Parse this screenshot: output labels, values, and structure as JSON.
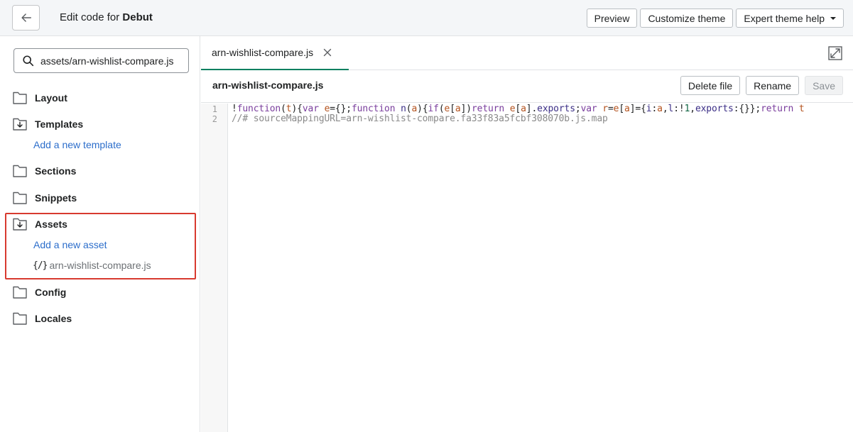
{
  "header": {
    "title_prefix": "Edit code for",
    "theme_name": "Debut",
    "buttons": {
      "preview": "Preview",
      "customize": "Customize theme",
      "expert_help": "Expert theme help"
    }
  },
  "sidebar": {
    "search_value": "assets/arn-wishlist-compare.js",
    "folders": {
      "layout": "Layout",
      "templates": "Templates",
      "sections": "Sections",
      "snippets": "Snippets",
      "assets": "Assets",
      "config": "Config",
      "locales": "Locales"
    },
    "add_template": "Add a new template",
    "add_asset": "Add a new asset",
    "asset_file": "arn-wishlist-compare.js",
    "asset_file_icon": "{/}"
  },
  "editor": {
    "tab_label": "arn-wishlist-compare.js",
    "filename": "arn-wishlist-compare.js",
    "buttons": {
      "delete": "Delete file",
      "rename": "Rename",
      "save": "Save"
    },
    "line_numbers": [
      "1",
      "2"
    ],
    "line1_tokens": [
      {
        "t": "!",
        "c": "plain"
      },
      {
        "t": "function",
        "c": "kw"
      },
      {
        "t": "(",
        "c": "plain"
      },
      {
        "t": "t",
        "c": "var"
      },
      {
        "t": "){",
        "c": "plain"
      },
      {
        "t": "var",
        "c": "kw"
      },
      {
        "t": " ",
        "c": "plain"
      },
      {
        "t": "e",
        "c": "var"
      },
      {
        "t": "={};",
        "c": "plain"
      },
      {
        "t": "function",
        "c": "kw"
      },
      {
        "t": " ",
        "c": "plain"
      },
      {
        "t": "n",
        "c": "prop"
      },
      {
        "t": "(",
        "c": "plain"
      },
      {
        "t": "a",
        "c": "var"
      },
      {
        "t": "){",
        "c": "plain"
      },
      {
        "t": "if",
        "c": "kw"
      },
      {
        "t": "(",
        "c": "plain"
      },
      {
        "t": "e",
        "c": "var"
      },
      {
        "t": "[",
        "c": "plain"
      },
      {
        "t": "a",
        "c": "var"
      },
      {
        "t": "])",
        "c": "plain"
      },
      {
        "t": "return",
        "c": "kw"
      },
      {
        "t": " ",
        "c": "plain"
      },
      {
        "t": "e",
        "c": "var"
      },
      {
        "t": "[",
        "c": "plain"
      },
      {
        "t": "a",
        "c": "var"
      },
      {
        "t": "].",
        "c": "plain"
      },
      {
        "t": "exports",
        "c": "prop"
      },
      {
        "t": ";",
        "c": "plain"
      },
      {
        "t": "var",
        "c": "kw"
      },
      {
        "t": " ",
        "c": "plain"
      },
      {
        "t": "r",
        "c": "var"
      },
      {
        "t": "=",
        "c": "plain"
      },
      {
        "t": "e",
        "c": "var"
      },
      {
        "t": "[",
        "c": "plain"
      },
      {
        "t": "a",
        "c": "var"
      },
      {
        "t": "]={",
        "c": "plain"
      },
      {
        "t": "i",
        "c": "prop"
      },
      {
        "t": ":",
        "c": "plain"
      },
      {
        "t": "a",
        "c": "var"
      },
      {
        "t": ",",
        "c": "plain"
      },
      {
        "t": "l",
        "c": "prop"
      },
      {
        "t": ":!",
        "c": "plain"
      },
      {
        "t": "1",
        "c": "num"
      },
      {
        "t": ",",
        "c": "plain"
      },
      {
        "t": "exports",
        "c": "prop"
      },
      {
        "t": ":{}};",
        "c": "plain"
      },
      {
        "t": "return",
        "c": "kw"
      },
      {
        "t": " t",
        "c": "var"
      }
    ],
    "line2": "//# sourceMappingURL=arn-wishlist-compare.fa33f83a5fcbf308070b.js.map"
  },
  "icons": {
    "back": "arrow-left-icon",
    "search": "search-icon",
    "folder": "folder-icon",
    "folder_open": "folder-download-icon",
    "close": "close-icon",
    "expand": "expand-icon",
    "file": "code-file-icon"
  },
  "colors": {
    "link": "#2c6ecb",
    "tab_active": "#008060",
    "highlight_border": "#d83a2f"
  }
}
